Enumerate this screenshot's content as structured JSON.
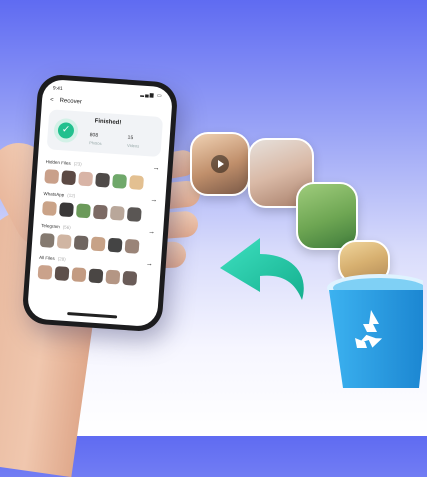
{
  "phone": {
    "status_time": "9:41",
    "nav": {
      "back_label": "<",
      "title": "Recover"
    },
    "summary": {
      "status": "Finished!",
      "left_value": "808",
      "left_label": "Photos",
      "right_value": "15",
      "right_label": "Videos"
    },
    "sections": [
      {
        "title": "Hidden Files",
        "count": "(23)"
      },
      {
        "title": "WhatsApp",
        "count": "(12)"
      },
      {
        "title": "Telegram",
        "count": "(56)"
      },
      {
        "title": "All Files",
        "count": "(28)"
      }
    ]
  },
  "icons": [
    "check-icon",
    "back-arrow-icon",
    "right-arrow-icon",
    "play-icon",
    "recycle-icon",
    "undo-arrow-icon"
  ],
  "colors": {
    "accent_green": "#22c08e",
    "arrow_teal": "#2ad6b4",
    "bin_blue": "#2aa6ea",
    "bg_top": "#5f6bf2"
  }
}
